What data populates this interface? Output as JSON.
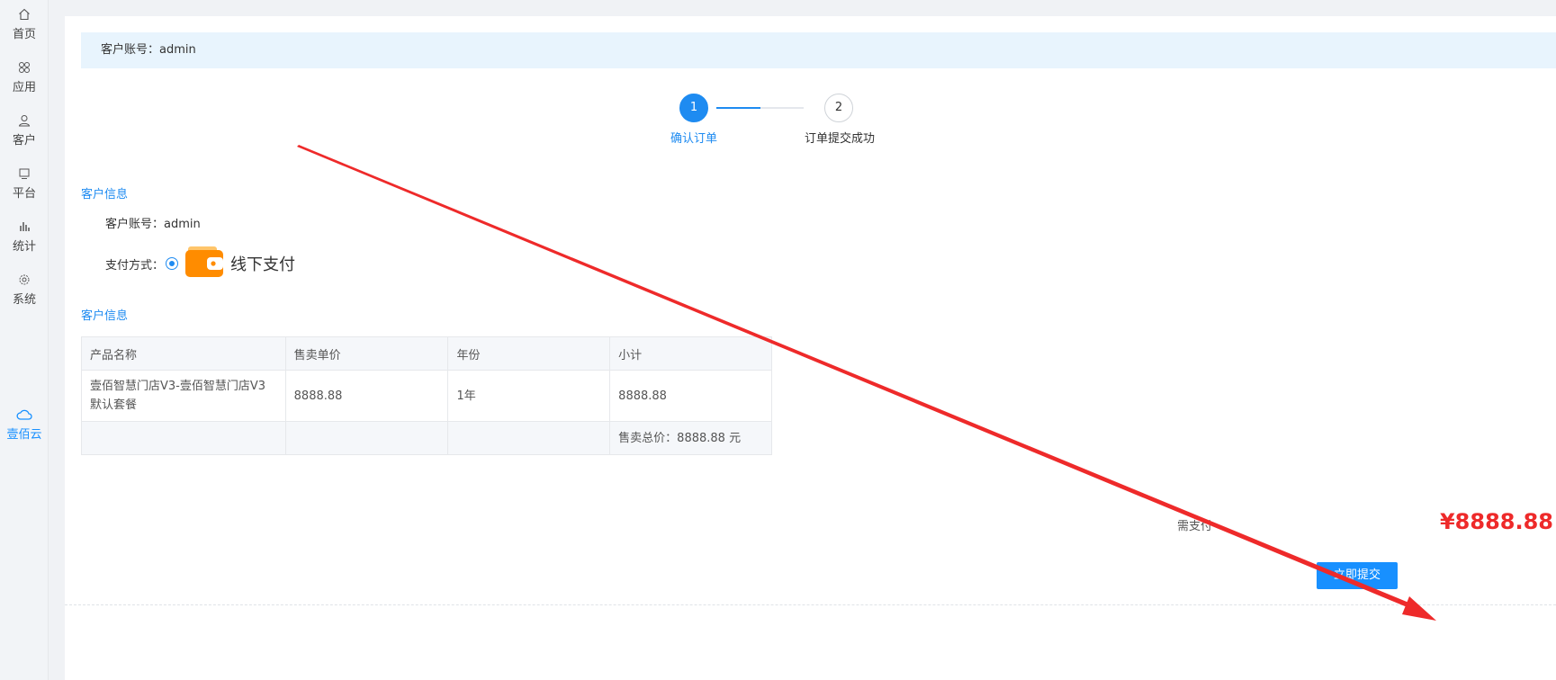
{
  "sidebar": {
    "items": [
      {
        "label": "首页",
        "icon": "home-icon"
      },
      {
        "label": "应用",
        "icon": "apps-icon"
      },
      {
        "label": "客户",
        "icon": "user-icon"
      },
      {
        "label": "平台",
        "icon": "monitor-icon"
      },
      {
        "label": "统计",
        "icon": "bar-chart-icon"
      },
      {
        "label": "系统",
        "icon": "gear-icon"
      }
    ],
    "brand": {
      "label": "壹佰云",
      "icon": "cloud-icon"
    }
  },
  "banner": {
    "text": "客户账号：admin"
  },
  "steps": [
    {
      "number": "1",
      "label": "确认订单",
      "state": "active"
    },
    {
      "number": "2",
      "label": "订单提交成功",
      "state": "todo"
    }
  ],
  "customer_section": {
    "title": "客户信息",
    "account": "客户账号：admin",
    "payment_label": "支付方式：",
    "payment_option": "线下支付",
    "payment_icon": "wallet-icon"
  },
  "order_section": {
    "title": "客户信息"
  },
  "table": {
    "headers": [
      "产品名称",
      "售卖单价",
      "年份",
      "小计"
    ],
    "rows": [
      [
        "壹佰智慧门店V3-壹佰智慧门店V3默认套餐",
        "8888.88",
        "1年",
        "8888.88"
      ]
    ],
    "total": "售卖总价：8888.88 元"
  },
  "footer": {
    "due_label": "需支付",
    "amount": "¥8888.88",
    "submit_label": "立即提交"
  },
  "colors": {
    "accent": "#1e8bf1",
    "amount": "#ee2a2a",
    "annotation_arrow": "#ee2a2a",
    "wallet": "#ff8c00"
  }
}
